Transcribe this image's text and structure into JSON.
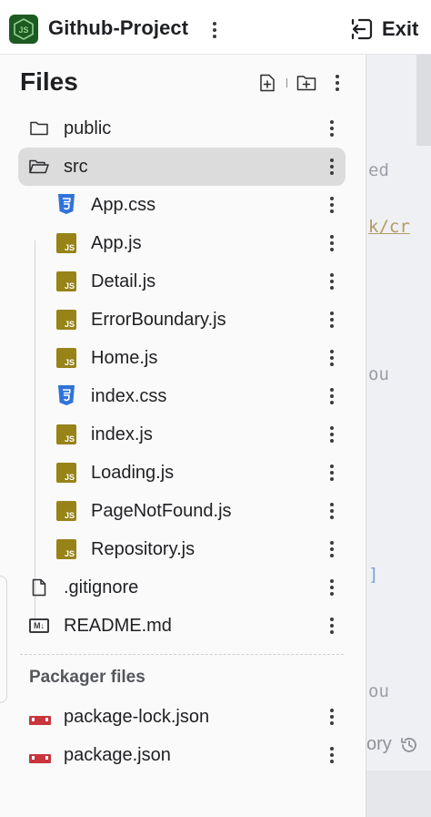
{
  "app": {
    "title": "Github-Project",
    "exit_label": "Exit",
    "accent": "#1d5a21"
  },
  "panel": {
    "title": "Files",
    "actions": [
      "new-file-icon",
      "new-folder-icon",
      "more-options-icon"
    ]
  },
  "tree": [
    {
      "name": "public",
      "icon": "folder-icon",
      "depth": 0,
      "selected": false
    },
    {
      "name": "src",
      "icon": "folder-open-icon",
      "depth": 0,
      "selected": true
    },
    {
      "name": "App.css",
      "icon": "css-icon",
      "depth": 1,
      "selected": false
    },
    {
      "name": "App.js",
      "icon": "js-icon",
      "depth": 1,
      "selected": false
    },
    {
      "name": "Detail.js",
      "icon": "js-icon",
      "depth": 1,
      "selected": false
    },
    {
      "name": "ErrorBoundary.js",
      "icon": "js-icon",
      "depth": 1,
      "selected": false
    },
    {
      "name": "Home.js",
      "icon": "js-icon",
      "depth": 1,
      "selected": false
    },
    {
      "name": "index.css",
      "icon": "css-icon",
      "depth": 1,
      "selected": false
    },
    {
      "name": "index.js",
      "icon": "js-icon",
      "depth": 1,
      "selected": false
    },
    {
      "name": "Loading.js",
      "icon": "js-icon",
      "depth": 1,
      "selected": false
    },
    {
      "name": "PageNotFound.js",
      "icon": "js-icon",
      "depth": 1,
      "selected": false
    },
    {
      "name": "Repository.js",
      "icon": "js-icon",
      "depth": 1,
      "selected": false
    },
    {
      "name": ".gitignore",
      "icon": "file-icon",
      "depth": 0,
      "selected": false
    },
    {
      "name": "README.md",
      "icon": "markdown-icon",
      "depth": 0,
      "selected": false
    }
  ],
  "packager": {
    "label": "Packager files",
    "files": [
      {
        "name": "package-lock.json",
        "icon": "npm-icon"
      },
      {
        "name": "package.json",
        "icon": "npm-icon"
      }
    ]
  },
  "editor_fragments": {
    "line1": "ed",
    "line2": "k/cr",
    "line3": "ou",
    "line4": "]",
    "line5": "ou",
    "history_label": "ory"
  },
  "colors": {
    "js": "#978318",
    "css": "#2f73d9",
    "npm": "#c9353c",
    "selected_row": "#dcdcdc"
  }
}
